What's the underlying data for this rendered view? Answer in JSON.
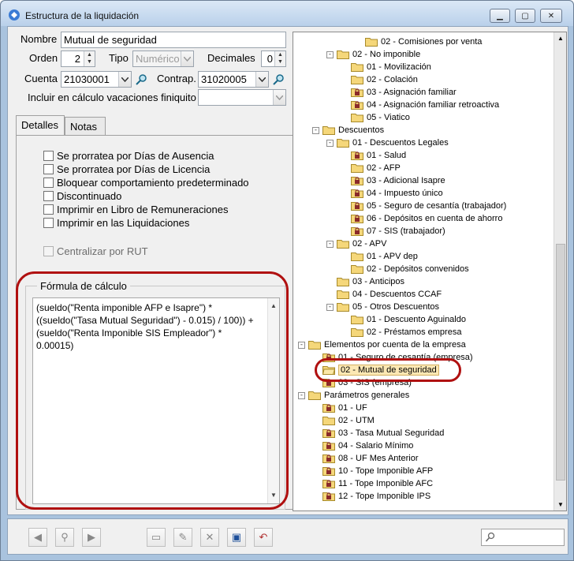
{
  "window": {
    "title": "Estructura de la liquidación",
    "controls": [
      "minimize",
      "maximize",
      "close"
    ]
  },
  "form": {
    "nombre_label": "Nombre",
    "nombre_value": "Mutual de seguridad",
    "orden_label": "Orden",
    "orden_value": "2",
    "tipo_label": "Tipo",
    "tipo_value": "Numérico",
    "decimales_label": "Decimales",
    "decimales_value": "0",
    "cuenta_label": "Cuenta",
    "cuenta_value": "21030001",
    "contrap_label": "Contrap.",
    "contrap_value": "31020005",
    "vacaciones_label": "Incluir en cálculo vacaciones finiquito",
    "vacaciones_value": ""
  },
  "tabs": [
    "Detalles",
    "Notas"
  ],
  "checkboxes": [
    "Se prorratea por Días de Ausencia",
    "Se prorratea por Días de Licencia",
    "Bloquear comportamiento predeterminado",
    "Discontinuado",
    "Imprimir en Libro de Remuneraciones",
    "Imprimir en las Liquidaciones"
  ],
  "centralizar_label": "Centralizar por RUT",
  "formula": {
    "legend": "Fórmula de cálculo",
    "text": "(sueldo(\"Renta imponible AFP e Isapre\") *\n((sueldo(\"Tasa Mutual Seguridad\") - 0.015) / 100)) +\n(sueldo(\"Renta Imponible SIS Empleador\") *\n0.00015)"
  },
  "tree": [
    {
      "label": "02 - Comisiones por venta",
      "level": 4,
      "icon": "folder"
    },
    {
      "label": "02 - No imponible",
      "level": 2,
      "icon": "folder",
      "expander": "-"
    },
    {
      "label": "01 - Movilización",
      "level": 3,
      "icon": "folder"
    },
    {
      "label": "02 - Colación",
      "level": 3,
      "icon": "folder"
    },
    {
      "label": "03 - Asignación familiar",
      "level": 3,
      "icon": "locked-folder"
    },
    {
      "label": "04 - Asignación familiar retroactiva",
      "level": 3,
      "icon": "locked-folder"
    },
    {
      "label": "05 - Viatico",
      "level": 3,
      "icon": "folder"
    },
    {
      "label": "Descuentos",
      "level": 1,
      "icon": "folder",
      "expander": "-"
    },
    {
      "label": "01 - Descuentos Legales",
      "level": 2,
      "icon": "folder",
      "expander": "-"
    },
    {
      "label": "01 - Salud",
      "level": 3,
      "icon": "locked-folder"
    },
    {
      "label": "02 - AFP",
      "level": 3,
      "icon": "folder"
    },
    {
      "label": "03 - Adicional Isapre",
      "level": 3,
      "icon": "locked-folder"
    },
    {
      "label": "04 - Impuesto único",
      "level": 3,
      "icon": "locked-folder"
    },
    {
      "label": "05 - Seguro de cesantía (trabajador)",
      "level": 3,
      "icon": "locked-folder"
    },
    {
      "label": "06 - Depósitos en cuenta de ahorro",
      "level": 3,
      "icon": "locked-folder"
    },
    {
      "label": "07 - SIS (trabajador)",
      "level": 3,
      "icon": "locked-folder"
    },
    {
      "label": "02 - APV",
      "level": 2,
      "icon": "folder",
      "expander": "-"
    },
    {
      "label": "01 - APV dep",
      "level": 3,
      "icon": "folder"
    },
    {
      "label": "02 - Depósitos convenidos",
      "level": 3,
      "icon": "folder"
    },
    {
      "label": "03 - Anticipos",
      "level": 2,
      "icon": "folder"
    },
    {
      "label": "04 - Descuentos CCAF",
      "level": 2,
      "icon": "folder"
    },
    {
      "label": "05 - Otros Descuentos",
      "level": 2,
      "icon": "folder",
      "expander": "-"
    },
    {
      "label": "01 - Descuento Aguinaldo",
      "level": 3,
      "icon": "folder"
    },
    {
      "label": "02 - Préstamos empresa",
      "level": 3,
      "icon": "folder"
    },
    {
      "label": "Elementos por cuenta de la empresa",
      "level": 0,
      "icon": "folder",
      "expander": "-"
    },
    {
      "label": "01 - Seguro de cesantía (empresa)",
      "level": 1,
      "icon": "locked-folder"
    },
    {
      "label": "02 - Mutual de seguridad",
      "level": 1,
      "icon": "open-folder",
      "selected": true
    },
    {
      "label": "03 - SIS (empresa)",
      "level": 1,
      "icon": "locked-folder"
    },
    {
      "label": "Parámetros generales",
      "level": 0,
      "icon": "folder",
      "expander": "-"
    },
    {
      "label": "01 - UF",
      "level": 1,
      "icon": "locked-folder"
    },
    {
      "label": "02 - UTM",
      "level": 1,
      "icon": "folder"
    },
    {
      "label": "03 - Tasa Mutual Seguridad",
      "level": 1,
      "icon": "locked-folder"
    },
    {
      "label": "04 - Salario Mínimo",
      "level": 1,
      "icon": "locked-folder"
    },
    {
      "label": "08 - UF Mes Anterior",
      "level": 1,
      "icon": "locked-folder"
    },
    {
      "label": "10 - Tope Imponible AFP",
      "level": 1,
      "icon": "locked-folder"
    },
    {
      "label": "11 - Tope Imponible AFC",
      "level": 1,
      "icon": "locked-folder"
    },
    {
      "label": "12 - Tope Imponible IPS",
      "level": 1,
      "icon": "locked-folder"
    }
  ],
  "toolbar": [
    "prev-icon",
    "binoculars-icon",
    "next-icon",
    "new-icon",
    "edit-icon",
    "delete-icon",
    "save-icon",
    "undo-icon"
  ],
  "search": {
    "value": ""
  },
  "colors": {
    "annotation": "#b01010",
    "folder": "#f5d77a",
    "lock": "#8a2a2a"
  }
}
